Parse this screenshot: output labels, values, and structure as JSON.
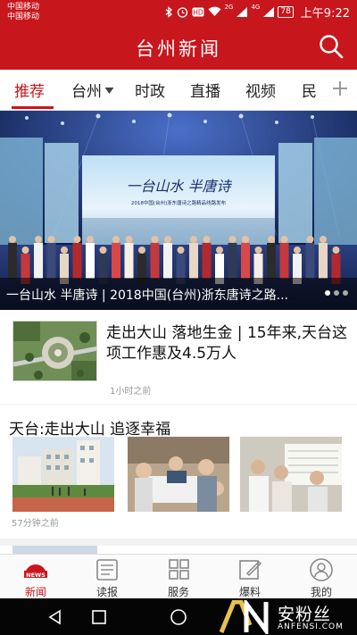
{
  "status_bar": {
    "carrier_1": "中国移动",
    "carrier_2": "中国移动",
    "signal_1": "2G",
    "signal_2": "4G",
    "battery": "78",
    "time": "上午9:22"
  },
  "header": {
    "title": "台州新闻",
    "icon": "search-icon"
  },
  "tabs": [
    {
      "label": "推荐",
      "active": true
    },
    {
      "label": "台州",
      "has_dropdown": true
    },
    {
      "label": "时政"
    },
    {
      "label": "直播"
    },
    {
      "label": "视频"
    },
    {
      "label": "民"
    }
  ],
  "hero": {
    "image_banner_text": "一台山水 半唐诗",
    "image_banner_subtext": "2018中国(台州)浙东唐诗之路精品线路发布",
    "caption": "一台山水 半唐诗 | 2018中国(台州)浙东唐诗之路...",
    "slide_count": 3,
    "active_slide": 1
  },
  "articles": [
    {
      "title": "走出大山 落地生金 | 15年来,天台这项工作惠及4.5万人",
      "time": "1小时之前"
    },
    {
      "title": "天台:走出大山 追逐幸福",
      "time": "57分钟之前"
    }
  ],
  "bottom_nav": [
    {
      "label": "新闻",
      "icon": "news-icon",
      "badge": "NEWS",
      "active": true
    },
    {
      "label": "读报",
      "icon": "newspaper-icon"
    },
    {
      "label": "服务",
      "icon": "grid-icon"
    },
    {
      "label": "爆料",
      "icon": "edit-icon"
    },
    {
      "label": "我的",
      "icon": "user-icon"
    }
  ],
  "watermark": {
    "name": "安粉丝",
    "sub": "ANFENSI.COM"
  },
  "colors": {
    "brand_red": "#c8161d"
  }
}
